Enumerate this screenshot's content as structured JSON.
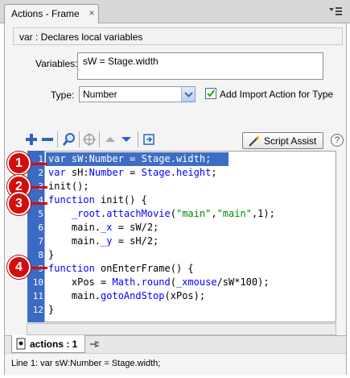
{
  "window": {
    "tab_title": "Actions - Frame",
    "close_glyph": "×"
  },
  "description": "var : Declares local variables",
  "variables": {
    "label": "Variables:",
    "value": "sW = Stage.width"
  },
  "type": {
    "label": "Type:",
    "selected": "Number"
  },
  "import_action": {
    "label": "Add Import Action for Type",
    "checked": true
  },
  "toolbar": {
    "icons": [
      "add-icon",
      "remove-icon",
      "find-icon",
      "target-icon",
      "move-up-icon",
      "move-down-icon",
      "apply-icon"
    ],
    "script_assist_label": "Script Assist",
    "help_glyph": "?"
  },
  "editor": {
    "line_numbers": [
      "1",
      "2",
      "3",
      "4",
      "5",
      "6",
      "7",
      "8",
      "9",
      "10",
      "11",
      "12"
    ],
    "current_line": 1,
    "lines": [
      "var sW:Number = Stage.width;",
      "var sH:Number = Stage.height;",
      "init();",
      "function init() {",
      "    _root.attachMovie(\"main\",\"main\",1);",
      "    main._x = sW/2;",
      "    main._y = sH/2;",
      "}",
      "function onEnterFrame() {",
      "    xPos = Math.round(_xmouse/sW*100);",
      "    main.gotoAndStop(xPos);",
      "}"
    ]
  },
  "markers": [
    "1",
    "2",
    "3",
    "4"
  ],
  "bottom_tab": {
    "label": "actions : 1"
  },
  "status": "Line 1: var sW:Number = Stage.width;",
  "colors": {
    "marker": "#d40d0d",
    "gutter": "#3b6ac4",
    "keyword": "#0000ff",
    "string": "#008a00"
  }
}
